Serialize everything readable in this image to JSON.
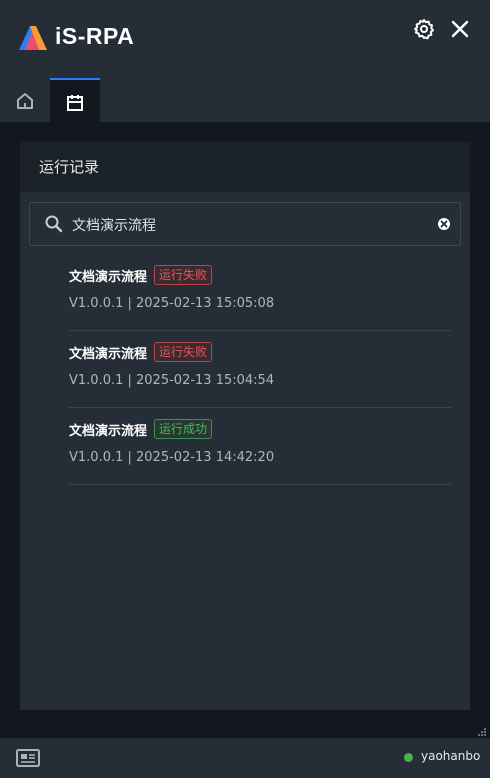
{
  "app": {
    "title": "iS-RPA"
  },
  "panel": {
    "title": "运行记录"
  },
  "search": {
    "value": "文档演示流程"
  },
  "records": [
    {
      "name": "文档演示流程",
      "status": "运行失败",
      "status_type": "fail",
      "meta": "V1.0.0.1 | 2025-02-13 15:05:08"
    },
    {
      "name": "文档演示流程",
      "status": "运行失败",
      "status_type": "fail",
      "meta": "V1.0.0.1 | 2025-02-13 15:04:54"
    },
    {
      "name": "文档演示流程",
      "status": "运行成功",
      "status_type": "success",
      "meta": "V1.0.0.1 | 2025-02-13 14:42:20"
    }
  ],
  "footer": {
    "username": "yaohanbo"
  },
  "colors": {
    "accent": "#2f7cf6",
    "fail": "#e0575a",
    "success": "#4cb36a",
    "online": "#4caf50"
  }
}
